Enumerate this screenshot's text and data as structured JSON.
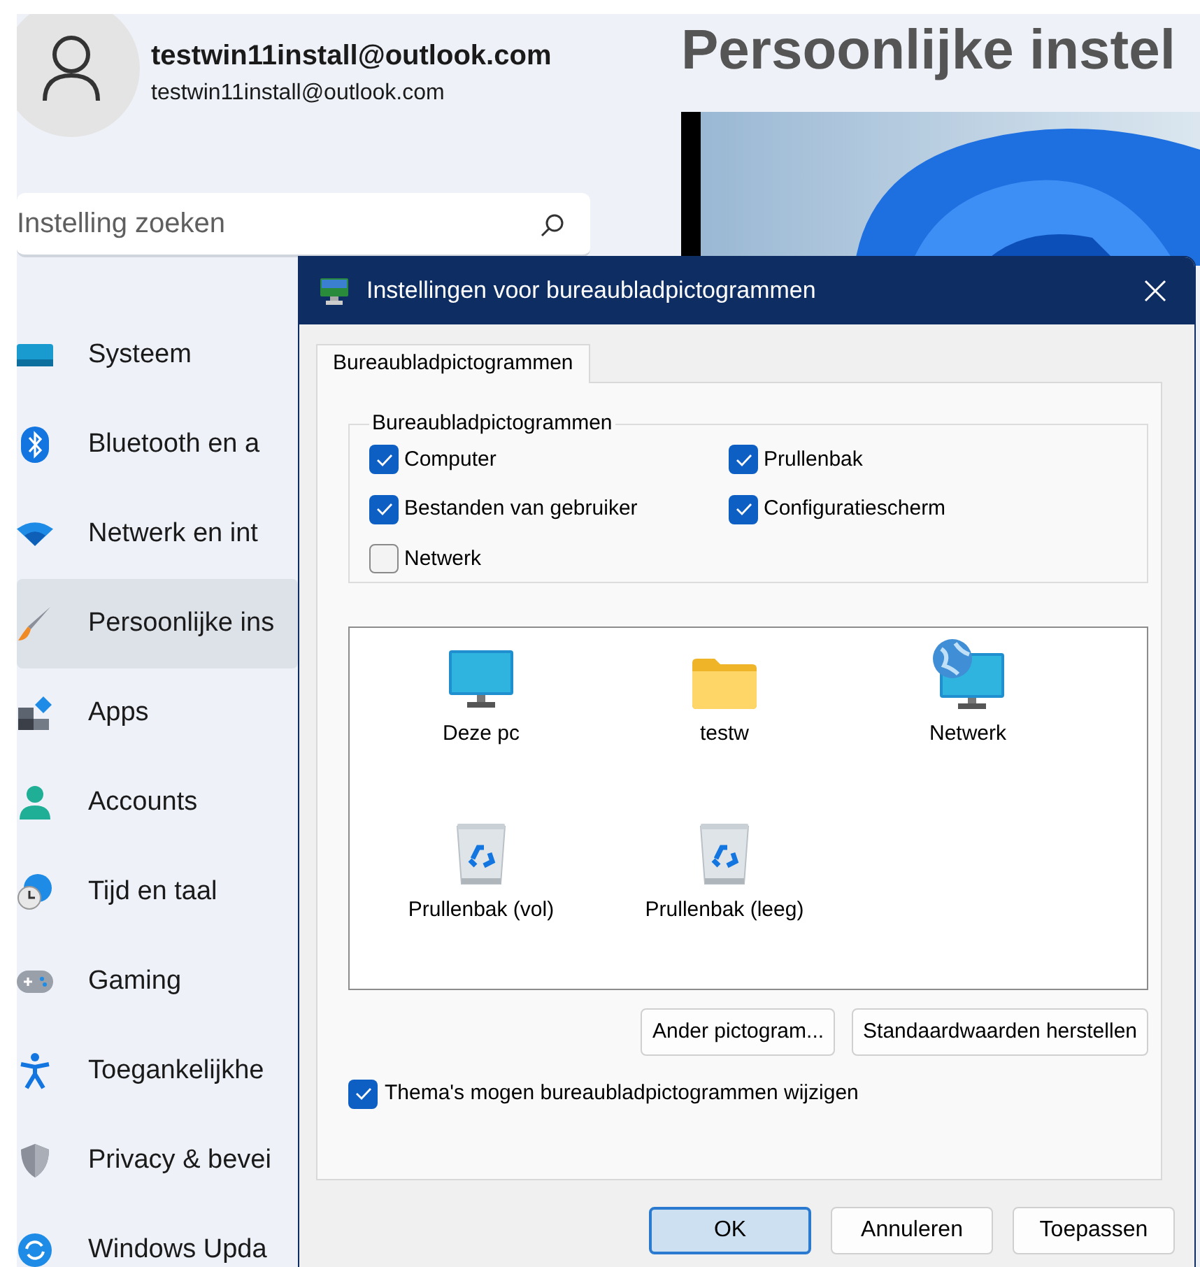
{
  "account": {
    "name": "testwin11install@outlook.com",
    "email": "testwin11install@outlook.com"
  },
  "search": {
    "placeholder": "Instelling zoeken"
  },
  "page_title": "Persoonlijke instel",
  "sidebar": {
    "items": [
      {
        "label": "Systeem",
        "selected": false
      },
      {
        "label": "Bluetooth en a",
        "selected": false
      },
      {
        "label": "Netwerk en int",
        "selected": false
      },
      {
        "label": "Persoonlijke ins",
        "selected": true
      },
      {
        "label": "Apps",
        "selected": false
      },
      {
        "label": "Accounts",
        "selected": false
      },
      {
        "label": "Tijd en taal",
        "selected": false
      },
      {
        "label": "Gaming",
        "selected": false
      },
      {
        "label": "Toegankelijkhe",
        "selected": false
      },
      {
        "label": "Privacy & bevei",
        "selected": false
      },
      {
        "label": "Windows Upda",
        "selected": false
      }
    ]
  },
  "dialog": {
    "title": "Instellingen voor bureaubladpictogrammen",
    "tabs": [
      {
        "label": "Bureaubladpictogrammen",
        "selected": true
      }
    ],
    "group_title": "Bureaubladpictogrammen",
    "checkboxes": [
      {
        "label": "Computer",
        "checked": true
      },
      {
        "label": "Prullenbak",
        "checked": true
      },
      {
        "label": "Bestanden van gebruiker",
        "checked": true
      },
      {
        "label": "Configuratiescherm",
        "checked": true
      },
      {
        "label": "Netwerk",
        "checked": false
      }
    ],
    "icons": [
      {
        "label": "Deze pc",
        "kind": "monitor"
      },
      {
        "label": "testw",
        "kind": "folder"
      },
      {
        "label": "Netwerk",
        "kind": "network"
      },
      {
        "label": "Prullenbak (vol)",
        "kind": "bin"
      },
      {
        "label": "Prullenbak (leeg)",
        "kind": "bin"
      }
    ],
    "icon_buttons": [
      "Ander pictogram...",
      "Standaardwaarden herstellen"
    ],
    "theme_checkbox": {
      "label": "Thema's mogen bureaubladpictogrammen wijzigen",
      "checked": true
    },
    "buttons": [
      {
        "label": "OK",
        "default": true
      },
      {
        "label": "Annuleren",
        "default": false
      },
      {
        "label": "Toepassen",
        "default": false
      }
    ]
  }
}
